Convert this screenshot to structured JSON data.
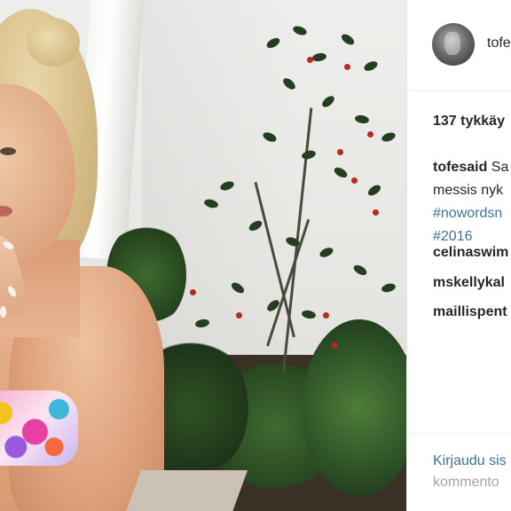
{
  "post": {
    "username": "tofe",
    "likes_text": "137 tykkäy",
    "caption": {
      "user": "tofesaid",
      "line1_rest": " Sa",
      "line2": "messis nyk",
      "tag1": "#nowordsn",
      "tag2": "#2016"
    },
    "comments": [
      {
        "user": "celinaswim"
      },
      {
        "user": "mskellykal"
      },
      {
        "user": "maillispent"
      }
    ],
    "login_text": "Kirjaudu sis",
    "comment_placeholder": "kommento"
  },
  "colors": {
    "link": "#3f729b",
    "text": "#262626",
    "muted": "#a5a5a5"
  }
}
